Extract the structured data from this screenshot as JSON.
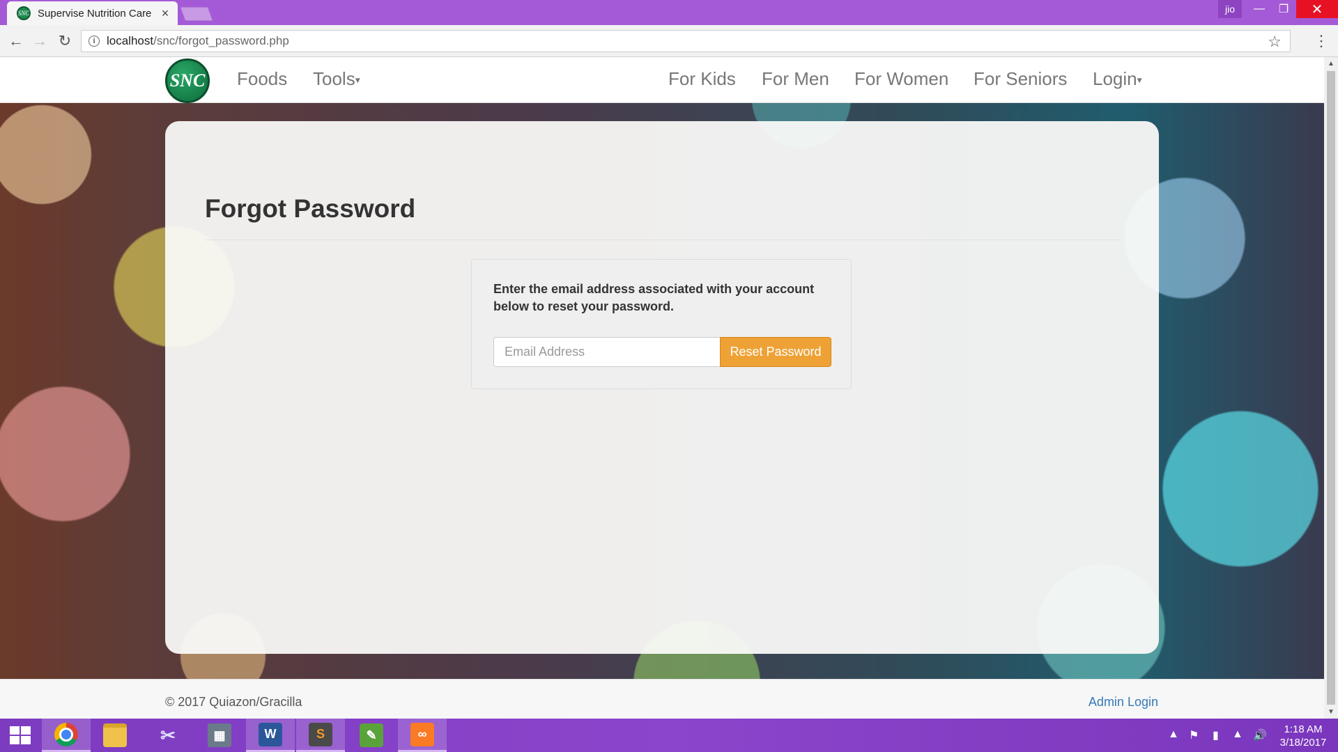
{
  "browser": {
    "tab_title": "Supervise Nutrition Care",
    "tab_close": "×",
    "url_host": "localhost",
    "url_path": "/snc/forgot_password.php",
    "user_badge": "jio"
  },
  "navbar": {
    "logo_text": "SNC",
    "left_links": [
      "Foods",
      "Tools"
    ],
    "right_links": [
      "For Kids",
      "For Men",
      "For Women",
      "For Seniors",
      "Login"
    ]
  },
  "page": {
    "title": "Forgot Password",
    "instructions": "Enter the email address associated with your account below to reset your password.",
    "email_placeholder": "Email Address",
    "email_value": "",
    "reset_button": "Reset Password"
  },
  "footer": {
    "copyright": "©  2017 Quiazon/Gracilla",
    "admin_link": "Admin Login"
  },
  "taskbar": {
    "apps": [
      "chrome-icon",
      "file-explorer-icon",
      "snipping-tool-icon",
      "calculator-icon",
      "word-icon",
      "sublime-text-icon",
      "paint-icon",
      "xampp-icon"
    ],
    "time": "1:18 AM",
    "date": "3/18/2017"
  },
  "colors": {
    "accent_button": "#eea236",
    "link": "#337ab7",
    "brand_green": "#1d8a4f",
    "taskbar": "#8b45cc"
  }
}
